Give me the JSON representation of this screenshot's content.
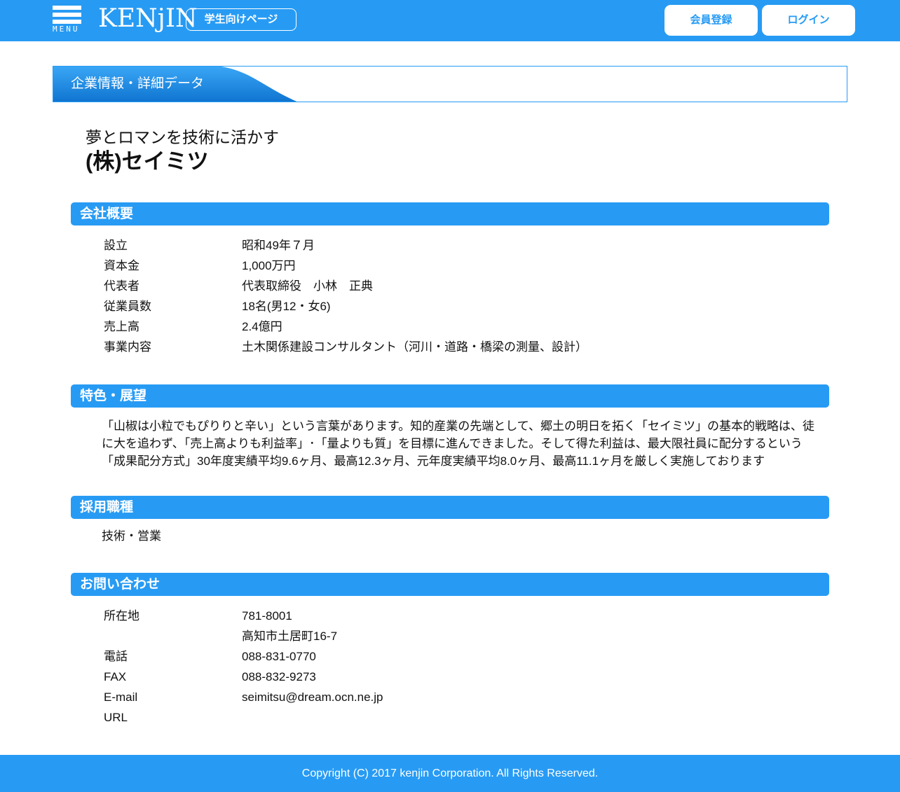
{
  "header": {
    "menu_label": "MENU",
    "logo_text": "KENjIN",
    "student_button": "学生向けページ",
    "register_button": "会員登録",
    "login_button": "ログイン",
    "colors": {
      "primary": "#279bf4",
      "white": "#ffffff"
    }
  },
  "banner": {
    "title": "企業情報・詳細データ"
  },
  "company": {
    "tagline": "夢とロマンを技術に活かす",
    "name": "(株)セイミツ"
  },
  "overview": {
    "heading": "会社概要",
    "rows": [
      {
        "label": "設立",
        "value": "昭和49年７月"
      },
      {
        "label": "資本金",
        "value": "1,000万円"
      },
      {
        "label": "代表者",
        "value": "代表取締役　小林　正典"
      },
      {
        "label": "従業員数",
        "value": "18名(男12・女6)"
      },
      {
        "label": "売上高",
        "value": "2.4億円"
      },
      {
        "label": "事業内容",
        "value": "土木関係建設コンサルタント（河川・道路・橋梁の測量、設計）"
      }
    ]
  },
  "features": {
    "heading": "特色・展望",
    "lines": [
      "「山椒は小粒でもぴりりと辛い」という言葉があります。知的産業の先端として、郷土の明日を拓く「セイミツ」の基本的戦略は、徒",
      "に大を追わず、「売上高よりも利益率」･「量よりも質」を目標に進んできました。そして得た利益は、最大限社員に配分するという",
      "「成果配分方式」30年度実績平均9.6ヶ月、最高12.3ヶ月、元年度実績平均8.0ヶ月、最高11.1ヶ月を厳しく実施しております"
    ]
  },
  "recruit": {
    "heading": "採用職種",
    "jobs": "技術・営業"
  },
  "contact": {
    "heading": "お問い合わせ",
    "rows": [
      {
        "label": "所在地",
        "value": "781-8001"
      },
      {
        "label": "",
        "value": "高知市土居町16-7"
      },
      {
        "label": "電話",
        "value": "088-831-0770"
      },
      {
        "label": "FAX",
        "value": "088-832-9273"
      },
      {
        "label": "E-mail",
        "value": "seimitsu@dream.ocn.ne.jp"
      },
      {
        "label": "URL",
        "value": ""
      }
    ]
  },
  "footer": {
    "copyright": "Copyright (C) 2017 kenjin Corporation. All Rights Reserved."
  }
}
